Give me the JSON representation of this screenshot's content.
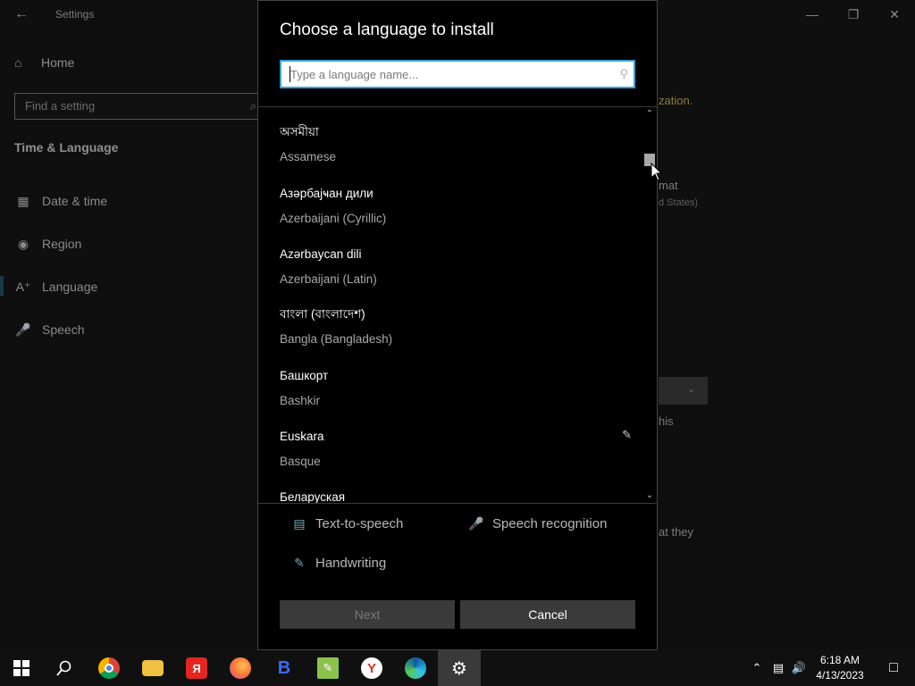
{
  "settings": {
    "title": "Settings",
    "home_label": "Home",
    "search_placeholder": "Find a setting",
    "section_title": "Time & Language",
    "nav": [
      {
        "label": "Date & time",
        "icon": "calendar-clock-icon"
      },
      {
        "label": "Region",
        "icon": "globe-icon"
      },
      {
        "label": "Language",
        "icon": "language-icon"
      },
      {
        "label": "Speech",
        "icon": "microphone-icon"
      }
    ],
    "background_fragments": {
      "zation": "zation.",
      "mat": "mat",
      "states": "d States)",
      "this": "his",
      "they": "at they"
    }
  },
  "dialog": {
    "title": "Choose a language to install",
    "search_placeholder": "Type a language name...",
    "languages": [
      {
        "native": "অসমীয়া",
        "english": "Assamese",
        "handwriting": false
      },
      {
        "native": "Азәрбајҹан дили",
        "english": "Azerbaijani (Cyrillic)",
        "handwriting": false
      },
      {
        "native": "Azərbaycan dili",
        "english": "Azerbaijani (Latin)",
        "handwriting": false
      },
      {
        "native": "বাংলা (বাংলাদেশ)",
        "english": "Bangla (Bangladesh)",
        "handwriting": false
      },
      {
        "native": "Башкорт",
        "english": "Bashkir",
        "handwriting": false
      },
      {
        "native": "Euskara",
        "english": "Basque",
        "handwriting": true
      },
      {
        "native": "Беларуская",
        "english": "",
        "handwriting": false
      }
    ],
    "features": {
      "tts": "Text-to-speech",
      "speech": "Speech recognition",
      "handwriting": "Handwriting"
    },
    "buttons": {
      "next": "Next",
      "cancel": "Cancel"
    }
  },
  "taskbar": {
    "apps": [
      {
        "name": "chrome",
        "icon": "chrome-icon"
      },
      {
        "name": "file-explorer",
        "icon": "folder-icon"
      },
      {
        "name": "yandex",
        "icon": "yandex-icon"
      },
      {
        "name": "firefox",
        "icon": "firefox-icon"
      },
      {
        "name": "brave",
        "icon": "brave-icon"
      },
      {
        "name": "notepad-plus",
        "icon": "notepad-icon"
      },
      {
        "name": "yandex-browser",
        "icon": "yandex-browser-icon"
      },
      {
        "name": "edge",
        "icon": "edge-icon"
      },
      {
        "name": "settings",
        "icon": "gear-icon"
      }
    ],
    "time": "6:18 AM",
    "date": "4/13/2023"
  },
  "colors": {
    "accent": "#3aa0d6",
    "dialog_bg": "#000000",
    "button_bg": "#3a3a3a"
  }
}
